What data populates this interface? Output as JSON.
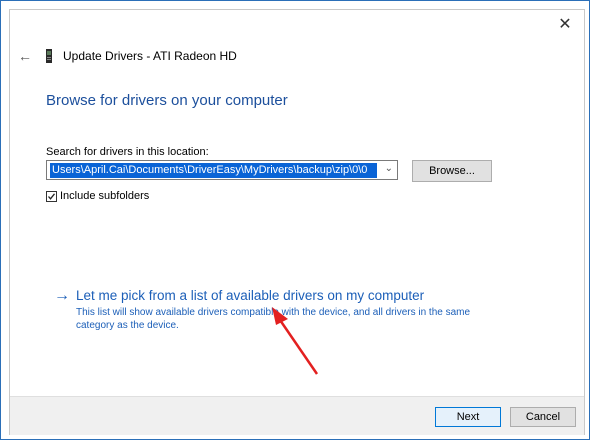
{
  "window": {
    "title": "Update Drivers - ATI Radeon HD",
    "close_glyph": "✕",
    "back_glyph": "←"
  },
  "heading": "Browse for drivers on your computer",
  "search": {
    "label": "Search for drivers in this location:",
    "path_value": "Users\\April.Cai\\Documents\\DriverEasy\\MyDrivers\\backup\\zip\\0\\0",
    "browse_label": "Browse..."
  },
  "subfolders": {
    "label": "Include subfolders",
    "checked": true
  },
  "pick": {
    "arrow_glyph": "→",
    "title": "Let me pick from a list of available drivers on my computer",
    "description": "This list will show available drivers compatible with the device, and all drivers in the same category as the device."
  },
  "buttons": {
    "next": "Next",
    "cancel": "Cancel"
  },
  "colors": {
    "link_blue": "#1c5fb8",
    "selection_blue": "#0a64d6",
    "annotation_red": "#e32020"
  }
}
